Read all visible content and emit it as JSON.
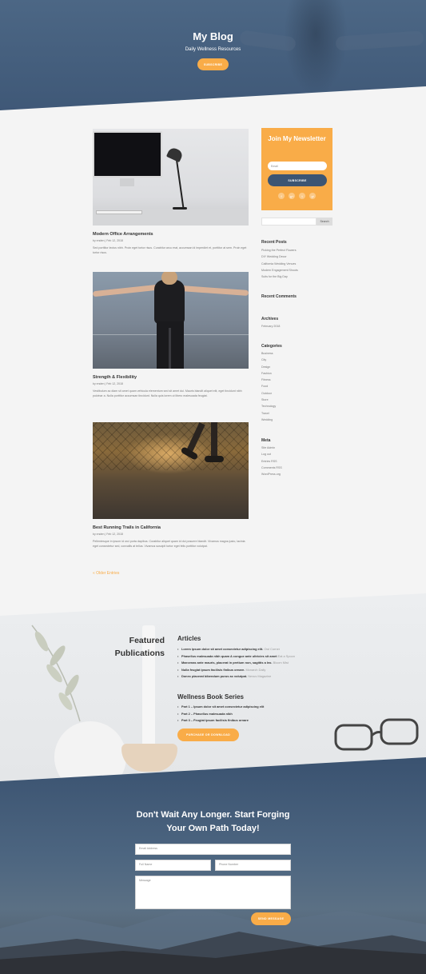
{
  "hero": {
    "title": "My Blog",
    "subtitle": "Daily Wellness Resources",
    "button": "SUBSCRIBE"
  },
  "posts": [
    {
      "title": "Modern Office Arrangements",
      "meta": "by enden | Feb 12, 2018",
      "excerpt": "Sed porttitor lectus nibh. Proin eget tortor risus. Curabitur arcu erat, accumsan id imperdiet et, porttitor at sem. Proin eget tortor risus."
    },
    {
      "title": "Strength & Flexibility",
      "meta": "by enden | Feb 12, 2018",
      "excerpt": "Vestibulum ac diam sit amet quam vehicula elementum sed sit amet dui. Mauris blandit aliquet elit, eget tincidunt nibh pulvinar a. Nulla porttitor accumsan tincidunt. Nulla quis lorem ut libero malesuada feugiat."
    },
    {
      "title": "Best Running Trails in California",
      "meta": "by enden | Feb 12, 2018",
      "excerpt": "Pellentesque in ipsum id orci porta dapibus. Curabitur aliquet quam id dui posuere blandit. Vivamus magna justo, lacinia eget consectetur sed, convallis at tellus. Vivamus suscipit tortor eget felis porttitor volutpat."
    }
  ],
  "older_entries": "« Older Entries",
  "sidebar": {
    "newsletter": {
      "title": "Join My Newsletter",
      "email_placeholder": "Email",
      "button": "SUBSCRIBE",
      "socials": [
        "f",
        "g+",
        "t",
        "yt"
      ]
    },
    "search_button": "Search",
    "recent_posts": {
      "heading": "Recent Posts",
      "items": [
        "Picking the Perfect Flowers",
        "DIY Wedding Decor",
        "California Wedding Venues",
        "Modern Engagement Shoots",
        "Suits for the Big Day"
      ]
    },
    "recent_comments": {
      "heading": "Recent Comments"
    },
    "archives": {
      "heading": "Archives",
      "items": [
        "February 2018"
      ]
    },
    "categories": {
      "heading": "Categories",
      "items": [
        "Business",
        "City",
        "Design",
        "Fashion",
        "Fitness",
        "Food",
        "Outdoor",
        "Store",
        "Technology",
        "Travel",
        "Wedding"
      ]
    },
    "meta": {
      "heading": "Meta",
      "items": [
        "Site Admin",
        "Log out",
        "Entries RSS",
        "Comments RSS",
        "WordPress.org"
      ]
    }
  },
  "publications": {
    "title_line1": "Featured",
    "title_line2": "Publications",
    "articles_heading": "Articles",
    "articles": [
      {
        "text": "Lorem ipsum dolor sit amet consectetur adipiscing elit.",
        "source": "Owl Corner"
      },
      {
        "text": "Phasellus malesuada nibh quam A congue ante ultricies sit amet",
        "source": "Eat a Spoon"
      },
      {
        "text": "Maecenas ante mauris, placerat in pretium non, sagittis a leo.",
        "source": "Bloom Mist"
      },
      {
        "text": "Nulla feugiat ipsum facilisis finibus ornare.",
        "source": "Monarch Daily"
      },
      {
        "text": "Donec placerat bibendum purus ac volutpat.",
        "source": "Nexus Magazine"
      }
    ],
    "book_heading": "Wellness Book Series",
    "book_parts": [
      "Part 1 – Ipsum dolor sit amet consectetur adipiscing elit",
      "Part 2 – Phasellus malesuada nibh",
      "Part 3 – Feugiat ipsum facilisis finibus ornare"
    ],
    "button": "PURCHASE OR DOWNLOAD"
  },
  "contact": {
    "title_line1": "Don't Wait Any Longer. Start Forging",
    "title_line2": "Your Own Path Today!",
    "email_placeholder": "Email Address",
    "name_placeholder": "Full Name",
    "phone_placeholder": "Phone Number",
    "message_placeholder": "Message",
    "button": "SEND MESSAGE"
  },
  "colors": {
    "accent": "#f9ac48",
    "navy": "#3c5573",
    "background": "#f4f4f4"
  }
}
